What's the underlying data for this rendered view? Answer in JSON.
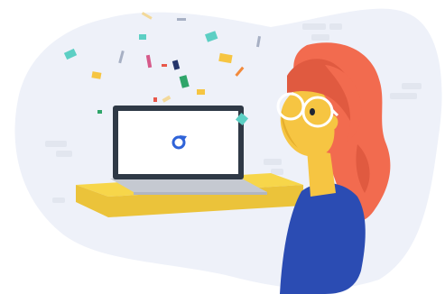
{
  "colors": {
    "page_bg": "#ffffff",
    "blob_bg": "#eef1f9",
    "wall_brick": "#e2e6ef",
    "shelf_top": "#f7d64a",
    "shelf_front": "#ebc33a",
    "laptop_frame": "#2f3946",
    "laptop_screen": "#ffffff",
    "laptop_keyboard": "#c5c9d1",
    "laptop_keyboard_shadow": "#b1b6c0",
    "loading_icon": "#2f63d8",
    "hair": "#f26b4f",
    "hair_dark": "#e05a40",
    "skin": "#f6c542",
    "skin_dark": "#e5ae2c",
    "shirt": "#2b4cb3",
    "glasses": "#ffffff",
    "glasses_outline": "#f4f4f4",
    "eye": "#1e2533",
    "confetti_teal": "#5ccfc4",
    "confetti_yellow": "#f6c542",
    "confetti_green": "#2fa56a",
    "confetti_navy": "#24356b",
    "confetti_orange": "#f28a3c",
    "confetti_red": "#e8574a",
    "confetti_pink": "#d65a8a",
    "confetti_grey": "#a7b0c4",
    "confetti_cream": "#f3d99a"
  },
  "illustration": {
    "subject": "woman-watching-laptop-loading",
    "icons": [
      "loading-spinner-icon"
    ]
  }
}
